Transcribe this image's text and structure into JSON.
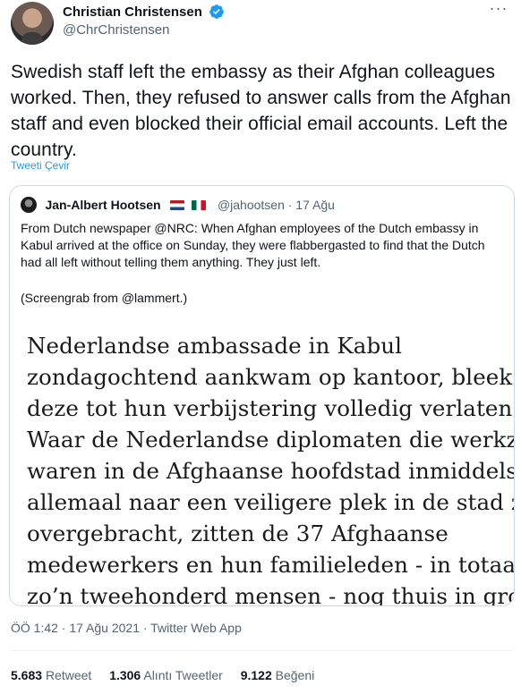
{
  "tweet": {
    "author": {
      "display_name": "Christian Christensen",
      "handle": "@ChrChristensen",
      "verified": true
    },
    "text": "Swedish staff left the embassy as their Afghan colleagues worked. Then, they refused to answer calls from the Afghan staff and even blocked their official email accounts. Left the country.",
    "translate_label": "Tweeti Çevir",
    "more_icon": "ellipsis-icon",
    "timestamp": "ÖÖ 1:42 · 17 Ağu 2021 · Twitter Web App",
    "stats": {
      "retweets_count": "5.683",
      "retweets_label": "Retweet",
      "quotes_count": "1.306",
      "quotes_label": "Alıntı Tweetler",
      "likes_count": "9.122",
      "likes_label": "Beğeni"
    }
  },
  "quoted_tweet": {
    "author": {
      "display_name": "Jan-Albert Hootsen",
      "flags": [
        "netherlands-flag",
        "mexico-flag"
      ],
      "handle_date": "@jahootsen · 17 Ağu"
    },
    "text": "From Dutch newspaper @NRC: When Afghan employees of the Dutch embassy in Kabul arrived at the office on Sunday, they were flabbergasted to find that the Dutch had all left without telling them anything. They just left.",
    "credit": "(Screengrab from @lammert.)",
    "image_lines": [
      "Nederlandse ambassade in Kabul",
      "zondagochtend aankwam op kantoor, bleek",
      "deze tot hun verbijstering volledig verlaten.",
      "Waar de Nederlandse diplomaten die werkzaam",
      "waren in de Afghaanse hoofdstad inmiddels",
      "allemaal naar een veiligere plek in de stad zijn",
      "overgebracht, zitten de 37 Afghaanse",
      "medewerkers en hun familieleden - in totaal",
      "zo’n tweehonderd mensen - nog thuis in grote"
    ]
  },
  "colors": {
    "accent": "#1d9bf0",
    "text": "#0f1419",
    "secondary": "#536471",
    "border": "#cfd9de"
  }
}
